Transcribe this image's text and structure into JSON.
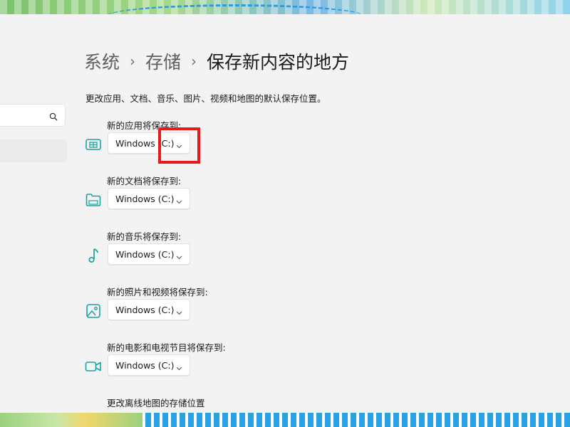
{
  "breadcrumb": {
    "items": [
      "系统",
      "存储",
      "保存新内容的地方"
    ],
    "separator": "›"
  },
  "description": "更改应用、文档、音乐、图片、视频和地图的默认保存位置。",
  "settings": [
    {
      "label": "新的应用将保存到:",
      "icon": "app-window-icon",
      "value": "Windows (C:)"
    },
    {
      "label": "新的文档将保存到:",
      "icon": "folder-icon",
      "value": "Windows (C:)"
    },
    {
      "label": "新的音乐将保存到:",
      "icon": "music-note-icon",
      "value": "Windows (C:)"
    },
    {
      "label": "新的照片和视频将保存到:",
      "icon": "picture-icon",
      "value": "Windows (C:)"
    },
    {
      "label": "新的电影和电视节目将保存到:",
      "icon": "video-camera-icon",
      "value": "Windows (C:)"
    }
  ],
  "offline_maps_label": "更改离线地图的存储位置",
  "colors": {
    "accent_icon": "#1aa3a3",
    "highlight": "#e81b1b",
    "page_bg": "#f3f3f3"
  }
}
